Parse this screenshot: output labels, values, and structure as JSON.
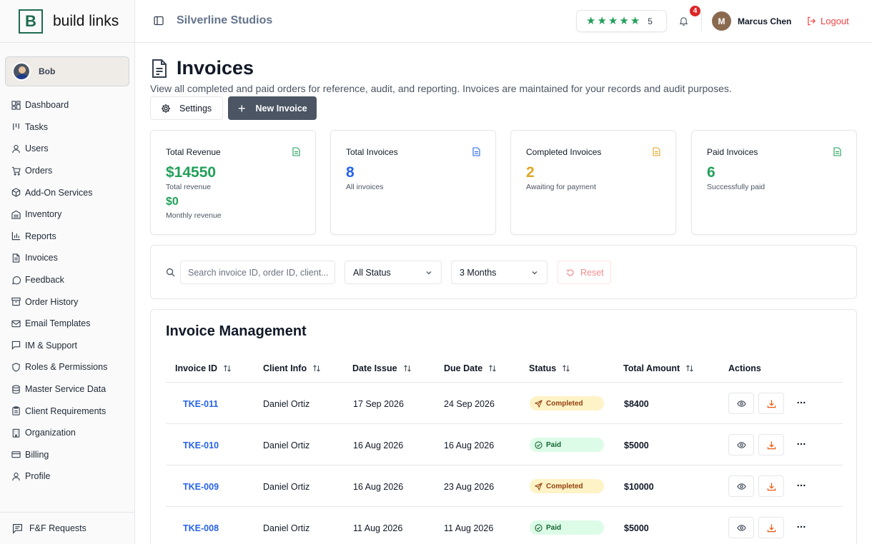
{
  "brand": {
    "logo_letter": "B",
    "name": "build links"
  },
  "sidebar": {
    "user": {
      "name": "Bob"
    },
    "items": [
      {
        "label": "Dashboard",
        "icon": "dashboard-icon"
      },
      {
        "label": "Tasks",
        "icon": "tasks-icon"
      },
      {
        "label": "Users",
        "icon": "user-icon"
      },
      {
        "label": "Orders",
        "icon": "cart-icon"
      },
      {
        "label": "Add-On Services",
        "icon": "package-icon"
      },
      {
        "label": "Inventory",
        "icon": "warehouse-icon"
      },
      {
        "label": "Reports",
        "icon": "bar-chart-icon"
      },
      {
        "label": "Invoices",
        "icon": "file-text-icon"
      },
      {
        "label": "Feedback",
        "icon": "message-circle-icon"
      },
      {
        "label": "Order History",
        "icon": "archive-icon"
      },
      {
        "label": "Email Templates",
        "icon": "mail-icon"
      },
      {
        "label": "IM & Support",
        "icon": "message-square-icon"
      },
      {
        "label": "Roles & Permissions",
        "icon": "shield-icon"
      },
      {
        "label": "Master Service Data",
        "icon": "database-icon"
      },
      {
        "label": "Client Requirements",
        "icon": "clipboard-icon"
      },
      {
        "label": "Organization",
        "icon": "building-icon"
      },
      {
        "label": "Billing",
        "icon": "credit-card-icon"
      },
      {
        "label": "Profile",
        "icon": "user-icon"
      }
    ],
    "footer": {
      "label": "F&F Requests",
      "icon": "message-square-icon"
    }
  },
  "header": {
    "company": "Silverline Studios",
    "rating": {
      "stars": 5,
      "value": "5"
    },
    "notifications": "4",
    "user": {
      "initial": "M",
      "name": "Marcus Chen"
    },
    "logout": "Logout"
  },
  "page": {
    "title": "Invoices",
    "subtitle": "View all completed and paid orders for reference, audit, and reporting. Invoices are maintained for your records and audit purposes.",
    "settings_label": "Settings",
    "new_invoice_label": "New Invoice"
  },
  "stats": [
    {
      "label": "Total Revenue",
      "value": "$14550",
      "sub": "Total revenue",
      "value2": "$0",
      "sub2": "Monthly revenue",
      "color": "#22a05a"
    },
    {
      "label": "Total Invoices",
      "value": "8",
      "sub": "All invoices",
      "color": "#2563eb"
    },
    {
      "label": "Completed Invoices",
      "value": "2",
      "sub": "Awaiting for payment",
      "color": "#e0a526"
    },
    {
      "label": "Paid Invoices",
      "value": "6",
      "sub": "Successfully paid",
      "color": "#22a05a"
    }
  ],
  "filters": {
    "search_placeholder": "Search invoice ID, order ID, client...",
    "status": "All Status",
    "period": "3 Months",
    "reset": "Reset"
  },
  "table": {
    "title": "Invoice Management",
    "columns": [
      "Invoice ID",
      "Client Info",
      "Date Issue",
      "Due Date",
      "Status",
      "Total Amount",
      "Actions"
    ],
    "rows": [
      {
        "id": "TKE-011",
        "client": "Daniel Ortiz",
        "issued": "17 Sep 2026",
        "due": "24 Sep 2026",
        "status": "Completed",
        "amount": "$8400"
      },
      {
        "id": "TKE-010",
        "client": "Daniel Ortiz",
        "issued": "16 Aug 2026",
        "due": "16 Aug 2026",
        "status": "Paid",
        "amount": "$5000"
      },
      {
        "id": "TKE-009",
        "client": "Daniel Ortiz",
        "issued": "16 Aug 2026",
        "due": "23 Aug 2026",
        "status": "Completed",
        "amount": "$10000"
      },
      {
        "id": "TKE-008",
        "client": "Daniel Ortiz",
        "issued": "11 Aug 2026",
        "due": "11 Aug 2026",
        "status": "Paid",
        "amount": "$5000"
      }
    ]
  },
  "colors": {
    "accent_dark": "#4b5563",
    "link": "#2563eb",
    "logout": "#ef4444",
    "completed_bg": "#fef3c7",
    "paid_bg": "#dcfce7"
  }
}
